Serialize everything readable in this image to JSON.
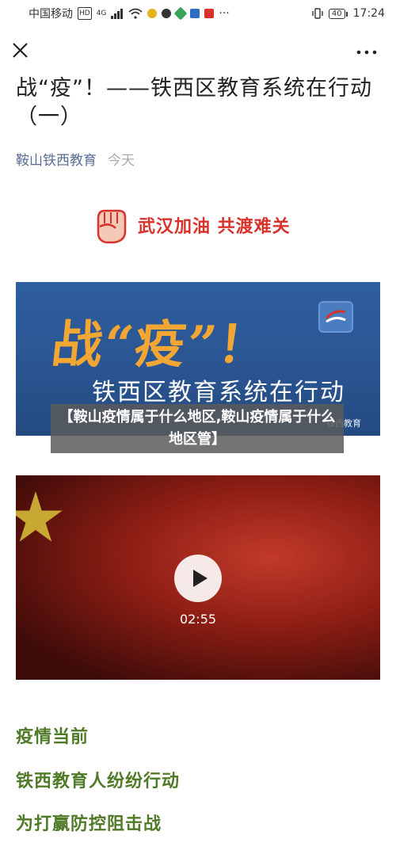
{
  "status_bar": {
    "carrier": "中国移动",
    "network": "4G",
    "more": "···",
    "time": "17:24",
    "battery": "40"
  },
  "nav": {
    "close_icon": "close-icon",
    "more_icon": "more-icon"
  },
  "article": {
    "title": "战“疫”！——铁西区教育系统在行动（一）",
    "author": "鞍山铁西教育",
    "date": "今天",
    "slogan": "武汉加油 共渡难关"
  },
  "banner": {
    "headline": "战“疫”！",
    "subline": "铁西区教育系统在行动",
    "source": "铁西教育"
  },
  "overlay": {
    "caption": "【鞍山疫情属于什么地区,鞍山疫情属于什么地区管】"
  },
  "video": {
    "duration": "02:55"
  },
  "sections": [
    "疫情当前",
    "铁西教育人纷纷行动",
    "为打赢防控阻击战"
  ],
  "colors": {
    "link": "#576b95",
    "slogan": "#d9322b",
    "section": "#4f7a28",
    "banner_bg": "#2f5e9e",
    "banner_headline": "#f2a634"
  }
}
